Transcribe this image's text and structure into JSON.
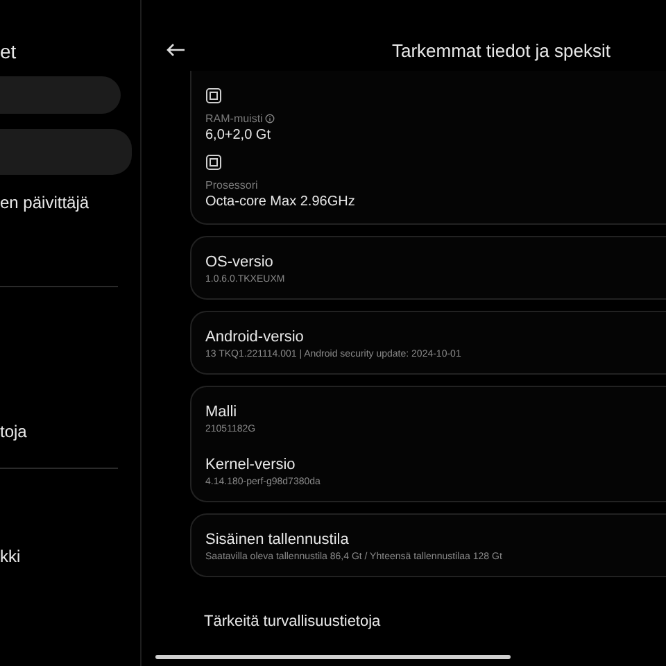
{
  "sidebar": {
    "title": "et",
    "items": [
      {
        "kind": "pill"
      },
      {
        "kind": "pill"
      },
      {
        "kind": "text",
        "label": "en päivittäjä"
      },
      {
        "kind": "divider"
      },
      {
        "kind": "text",
        "label": "toja"
      },
      {
        "kind": "divider"
      },
      {
        "kind": "text",
        "label": "kki"
      }
    ]
  },
  "header": {
    "title": "Tarkemmat tiedot ja speksit"
  },
  "specs": [
    {
      "label": "RAM-muisti",
      "value": "6,0+2,0 Gt",
      "info": true
    },
    {
      "label": "Prosessori",
      "value": "Octa-core Max 2.96GHz",
      "info": false
    }
  ],
  "cards": [
    {
      "items": [
        {
          "title": "OS-versio",
          "value": "1.0.6.0.TKXEUXM"
        }
      ]
    },
    {
      "items": [
        {
          "title": "Android-versio",
          "value": "13 TKQ1.221114.001 | Android security update: 2024-10-01"
        }
      ]
    },
    {
      "items": [
        {
          "title": "Malli",
          "value": "21051182G"
        },
        {
          "title": "Kernel-versio",
          "value": "4.14.180-perf-g98d7380da"
        }
      ]
    },
    {
      "items": [
        {
          "title": "Sisäinen tallennustila",
          "value": "Saatavilla oleva tallennustila  86,4 Gt / Yhteensä tallennustilaa  128 Gt"
        }
      ]
    }
  ],
  "footer_item": {
    "title": "Tärkeitä turvallisuustietoja"
  }
}
